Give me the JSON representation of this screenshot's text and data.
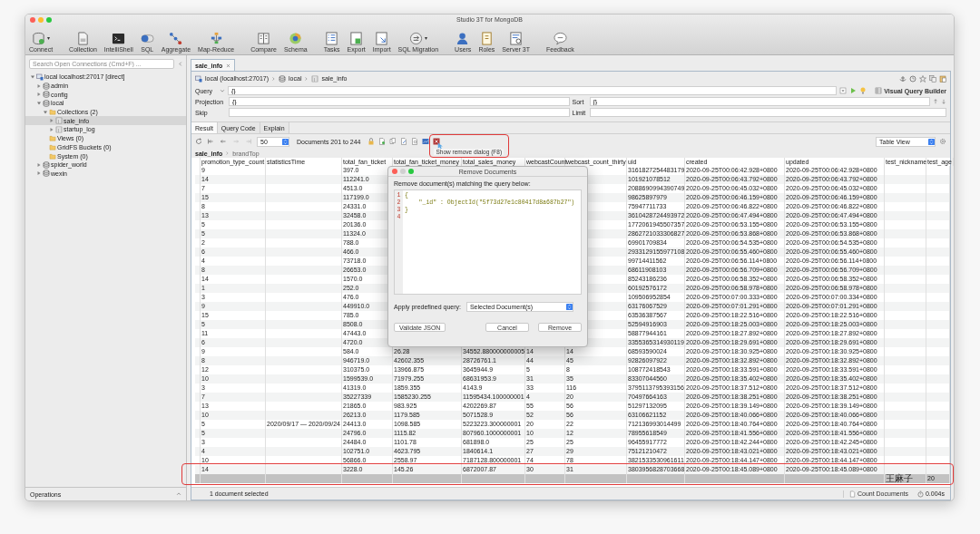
{
  "window": {
    "title": "Studio 3T for MongoDB"
  },
  "toolbar": {
    "groups": [
      [
        {
          "label": "Connect",
          "dropdown": true
        }
      ],
      [
        {
          "label": "Collection",
          "dropdown": false
        },
        {
          "label": "IntelliShell",
          "dropdown": false
        },
        {
          "label": "SQL",
          "dropdown": false
        },
        {
          "label": "Aggregate",
          "dropdown": false
        },
        {
          "label": "Map-Reduce",
          "dropdown": false
        }
      ],
      [
        {
          "label": "Compare",
          "dropdown": false
        },
        {
          "label": "Schema",
          "dropdown": false
        }
      ],
      [
        {
          "label": "Tasks",
          "dropdown": false
        },
        {
          "label": "Export",
          "dropdown": false
        },
        {
          "label": "Import",
          "dropdown": false
        },
        {
          "label": "SQL Migration",
          "dropdown": true
        }
      ],
      [
        {
          "label": "Users",
          "dropdown": false
        },
        {
          "label": "Roles",
          "dropdown": false
        },
        {
          "label": "Server 3T",
          "dropdown": false
        }
      ],
      [
        {
          "label": "Feedback",
          "dropdown": false
        }
      ]
    ]
  },
  "sidebar": {
    "search": {
      "placeholder": "Search Open Connections (Cmd+F) ..."
    },
    "tree": [
      {
        "label": "local localhost:27017 [direct]",
        "kind": "server",
        "expanded": true,
        "selected": false,
        "children": [
          {
            "label": "admin",
            "kind": "database",
            "expanded": false,
            "selected": false
          },
          {
            "label": "config",
            "kind": "database",
            "expanded": false,
            "selected": false
          },
          {
            "label": "local",
            "kind": "database",
            "expanded": true,
            "selected": false,
            "children": [
              {
                "label": "Collections (2)",
                "kind": "folder",
                "expanded": true,
                "selected": false,
                "children": [
                  {
                    "label": "sale_info",
                    "kind": "collection",
                    "expanded": false,
                    "selected": true
                  },
                  {
                    "label": "startup_log",
                    "kind": "collection",
                    "expanded": false,
                    "selected": false
                  }
                ]
              },
              {
                "label": "Views (0)",
                "kind": "folder",
                "selected": false
              },
              {
                "label": "GridFS Buckets (0)",
                "kind": "folder",
                "selected": false
              },
              {
                "label": "System (0)",
                "kind": "folder",
                "selected": false
              }
            ]
          },
          {
            "label": "spider_world",
            "kind": "database",
            "expanded": false,
            "selected": false
          },
          {
            "label": "wexin",
            "kind": "database",
            "expanded": false,
            "selected": false
          }
        ]
      }
    ],
    "footer": "Operations"
  },
  "editor_tabs": [
    {
      "label": "sale_info",
      "selected": true
    }
  ],
  "breadcrumb": [
    "local (localhost:27017)",
    "local",
    "sale_info"
  ],
  "query": {
    "label": "Query",
    "value": "{}"
  },
  "projection": {
    "label": "Projection",
    "value": "{}"
  },
  "sort": {
    "label": "Sort",
    "value": "{}"
  },
  "skip": {
    "label": "Skip"
  },
  "limit": {
    "label": "Limit"
  },
  "visual_query_builder": "Visual Query Builder",
  "result_tabs": [
    {
      "label": "Result",
      "selected": true
    },
    {
      "label": "Query Code",
      "selected": false
    },
    {
      "label": "Explain",
      "selected": false
    }
  ],
  "result_toolbar": {
    "nav_buttons": [
      {
        "disabled": false
      },
      {
        "disabled": false
      },
      {
        "disabled": true
      },
      {
        "disabled": true
      }
    ],
    "page_size": "50",
    "range": "Documents 201 to 244",
    "tooltip": "Show remove dialog (F8)",
    "view": "Table View"
  },
  "path": [
    "sale_info",
    "brandTop"
  ],
  "table": {
    "columns": [
      "promotion_type_count",
      "statisticsTime",
      "total_fan_ticket",
      "total_fan_ticket_money",
      "total_sales_money",
      "webcastCount",
      "webcast_count_thirty",
      "uid",
      "created",
      "updated",
      "test_nickname",
      "test_age"
    ],
    "rows": [
      {
        "selected": false,
        "cells": [
          "9",
          null,
          "397.0",
          null,
          null,
          null,
          null,
          "3161827254483179",
          "2020-09-25T00:06:42.928+0800",
          "2020-09-25T00:06:42.928+0800",
          null,
          null
        ]
      },
      {
        "selected": false,
        "cells": [
          "14",
          null,
          "112241.0",
          null,
          null,
          null,
          null,
          "101921078512",
          "2020-09-25T00:06:43.792+0800",
          "2020-09-25T00:06:43.792+0800",
          null,
          null
        ]
      },
      {
        "selected": false,
        "cells": [
          "7",
          null,
          "4513.0",
          null,
          null,
          null,
          null,
          "2088690994390749",
          "2020-09-25T00:06:45.032+0800",
          "2020-09-25T00:06:45.032+0800",
          null,
          null
        ]
      },
      {
        "selected": false,
        "cells": [
          "15",
          null,
          "117199.0",
          null,
          null,
          null,
          null,
          "98625897979",
          "2020-09-25T00:06:46.159+0800",
          "2020-09-25T00:06:46.159+0800",
          null,
          null
        ]
      },
      {
        "selected": false,
        "cells": [
          "8",
          null,
          "24331.0",
          null,
          null,
          null,
          null,
          "75947711733",
          "2020-09-25T00:06:46.822+0800",
          "2020-09-25T00:06:46.822+0800",
          null,
          null
        ]
      },
      {
        "selected": false,
        "cells": [
          "13",
          null,
          "32458.0",
          null,
          null,
          null,
          null,
          "3610428724493972",
          "2020-09-25T00:06:47.494+0800",
          "2020-09-25T00:06:47.494+0800",
          null,
          null
        ]
      },
      {
        "selected": false,
        "cells": [
          "5",
          null,
          "20136.0",
          null,
          null,
          null,
          null,
          "1772061945507357",
          "2020-09-25T00:06:53.155+0800",
          "2020-09-25T00:06:53.155+0800",
          null,
          null
        ]
      },
      {
        "selected": false,
        "cells": [
          "5",
          null,
          "11324.0",
          null,
          null,
          null,
          null,
          "2862721033306827",
          "2020-09-25T00:06:53.868+0800",
          "2020-09-25T00:06:53.868+0800",
          null,
          null
        ]
      },
      {
        "selected": false,
        "cells": [
          "2",
          null,
          "788.0",
          null,
          null,
          null,
          null,
          "69901709834",
          "2020-09-25T00:06:54.535+0800",
          "2020-09-25T00:06:54.535+0800",
          null,
          null
        ]
      },
      {
        "selected": false,
        "cells": [
          "6",
          null,
          "466.0",
          null,
          null,
          null,
          null,
          "2933129155977108",
          "2020-09-25T00:06:55.460+0800",
          "2020-09-25T00:06:55.460+0800",
          null,
          null
        ]
      },
      {
        "selected": false,
        "cells": [
          "4",
          null,
          "73718.0",
          null,
          null,
          null,
          null,
          "99714411562",
          "2020-09-25T00:06:56.114+0800",
          "2020-09-25T00:06:56.114+0800",
          null,
          null
        ]
      },
      {
        "selected": false,
        "cells": [
          "8",
          null,
          "26653.0",
          null,
          null,
          null,
          null,
          "68611908103",
          "2020-09-25T00:06:56.709+0800",
          "2020-09-25T00:06:56.709+0800",
          null,
          null
        ]
      },
      {
        "selected": false,
        "cells": [
          "14",
          null,
          "1570.0",
          null,
          null,
          null,
          null,
          "85243186236",
          "2020-09-25T00:06:58.352+0800",
          "2020-09-25T00:06:58.352+0800",
          null,
          null
        ]
      },
      {
        "selected": false,
        "cells": [
          "1",
          null,
          "252.0",
          null,
          null,
          null,
          null,
          "60192576172",
          "2020-09-25T00:06:58.978+0800",
          "2020-09-25T00:06:58.978+0800",
          null,
          null
        ]
      },
      {
        "selected": false,
        "cells": [
          "3",
          null,
          "476.0",
          null,
          null,
          null,
          null,
          "109506952854",
          "2020-09-25T00:07:00.333+0800",
          "2020-09-25T00:07:00.334+0800",
          null,
          null
        ]
      },
      {
        "selected": false,
        "cells": [
          "9",
          null,
          "449910.0",
          null,
          null,
          null,
          null,
          "63176067529",
          "2020-09-25T00:07:01.291+0800",
          "2020-09-25T00:07:01.291+0800",
          null,
          null
        ]
      },
      {
        "selected": false,
        "cells": [
          "15",
          null,
          "785.0",
          null,
          null,
          null,
          null,
          "63536387567",
          "2020-09-25T00:18:22.516+0800",
          "2020-09-25T00:18:22.516+0800",
          null,
          null
        ]
      },
      {
        "selected": false,
        "cells": [
          "5",
          null,
          "8508.0",
          null,
          null,
          null,
          null,
          "52594916903",
          "2020-09-25T00:18:25.003+0800",
          "2020-09-25T00:18:25.003+0800",
          null,
          null
        ]
      },
      {
        "selected": false,
        "cells": [
          "11",
          null,
          "47443.0",
          null,
          null,
          null,
          null,
          "58877944161",
          "2020-09-25T00:18:27.892+0800",
          "2020-09-25T00:18:27.892+0800",
          null,
          null
        ]
      },
      {
        "selected": false,
        "cells": [
          "6",
          null,
          "4720.0",
          null,
          null,
          null,
          null,
          "3355365314930119",
          "2020-09-25T00:18:29.691+0800",
          "2020-09-25T00:18:29.691+0800",
          null,
          null
        ]
      },
      {
        "selected": false,
        "cells": [
          "9",
          null,
          "584.0",
          "26.28",
          "34552.880000000005",
          "14",
          "14",
          "68593590024",
          "2020-09-25T00:18:30.925+0800",
          "2020-09-25T00:18:30.925+0800",
          null,
          null
        ]
      },
      {
        "selected": false,
        "cells": [
          "8",
          null,
          "946719.0",
          "42602.355",
          "28726761.1",
          "44",
          "45",
          "92826097922",
          "2020-09-25T00:18:32.892+0800",
          "2020-09-25T00:18:32.892+0800",
          null,
          null
        ]
      },
      {
        "selected": false,
        "cells": [
          "12",
          null,
          "310375.0",
          "13966.875",
          "3645944.9",
          "5",
          "8",
          "108772418543",
          "2020-09-25T00:18:33.591+0800",
          "2020-09-25T00:18:33.591+0800",
          null,
          null
        ]
      },
      {
        "selected": false,
        "cells": [
          "10",
          null,
          "1599539.0",
          "71979.255",
          "68631953.9",
          "31",
          "35",
          "83307044560",
          "2020-09-25T00:18:35.402+0800",
          "2020-09-25T00:18:35.402+0800",
          null,
          null
        ]
      },
      {
        "selected": false,
        "cells": [
          "3",
          null,
          "41319.0",
          "1859.355",
          "4143.9",
          "33",
          "116",
          "3795113795393156",
          "2020-09-25T00:18:37.512+0800",
          "2020-09-25T00:18:37.512+0800",
          null,
          null
        ]
      },
      {
        "selected": false,
        "cells": [
          "7",
          null,
          "35227339",
          "1585230.255",
          "11595434.100000001",
          "4",
          "20",
          "70497664163",
          "2020-09-25T00:18:38.251+0800",
          "2020-09-25T00:18:38.251+0800",
          null,
          null
        ]
      },
      {
        "selected": false,
        "cells": [
          "13",
          null,
          "21865.0",
          "983.925",
          "4202269.87",
          "55",
          "56",
          "51297132095",
          "2020-09-25T00:18:39.149+0800",
          "2020-09-25T00:18:39.149+0800",
          null,
          null
        ]
      },
      {
        "selected": false,
        "cells": [
          "10",
          null,
          "26213.0",
          "1179.585",
          "5071528.9",
          "52",
          "56",
          "63106621152",
          "2020-09-25T00:18:40.066+0800",
          "2020-09-25T00:18:40.066+0800",
          null,
          null
        ]
      },
      {
        "selected": false,
        "cells": [
          "5",
          "2020/09/17 — 2020/09/24",
          "24413.0",
          "1098.585",
          "5223223.300000001",
          "20",
          "22",
          "712136993014499",
          "2020-09-25T00:18:40.764+0800",
          "2020-09-25T00:18:40.764+0800",
          null,
          null
        ]
      },
      {
        "selected": false,
        "cells": [
          "5",
          null,
          "24796.0",
          "1115.82",
          "807960.1000000001",
          "10",
          "12",
          "78955618549",
          "2020-09-25T00:18:41.556+0800",
          "2020-09-25T00:18:41.556+0800",
          null,
          null
        ]
      },
      {
        "selected": false,
        "cells": [
          "3",
          null,
          "24484.0",
          "1101.78",
          "681898.0",
          "25",
          "25",
          "96455917772",
          "2020-09-25T00:18:42.244+0800",
          "2020-09-25T00:18:42.245+0800",
          null,
          null
        ]
      },
      {
        "selected": false,
        "cells": [
          "4",
          null,
          "102751.0",
          "4623.795",
          "1840614.1",
          "27",
          "29",
          "75121210472",
          "2020-09-25T00:18:43.021+0800",
          "2020-09-25T00:18:43.021+0800",
          null,
          null
        ]
      },
      {
        "selected": false,
        "cells": [
          "10",
          null,
          "56866.0",
          "2558.97",
          "7187128.800000001",
          "74",
          "78",
          "3821533530961611",
          "2020-09-25T00:18:44.147+0800",
          "2020-09-25T00:18:44.147+0800",
          null,
          null
        ]
      },
      {
        "selected": false,
        "cells": [
          "14",
          null,
          "3228.0",
          "145.26",
          "6872007.87",
          "30",
          "31",
          "3803956828703668",
          "2020-09-25T00:18:45.089+0800",
          "2020-09-25T00:18:45.089+0800",
          null,
          null
        ]
      },
      {
        "selected": true,
        "cells": [
          null,
          null,
          null,
          null,
          null,
          null,
          null,
          null,
          null,
          null,
          "王麻子",
          "20"
        ]
      }
    ]
  },
  "dialog": {
    "title": "Remove Documents",
    "prompt": "Remove document(s) matching the query below:",
    "line_numbers": [
      "1",
      "2",
      "3",
      "4"
    ],
    "code": [
      "{",
      "    \"_id\" : ObjectId(\"5f73d27e1c80417d8a687b27\")",
      "}"
    ],
    "predefined_label": "Apply predefined query:",
    "predefined_value": "Selected Document(s)",
    "buttons": [
      "Validate JSON",
      "Cancel",
      "Remove"
    ]
  },
  "status_bar": {
    "selection": "1 document selected",
    "count_button": "Count Documents",
    "time": "0.004s"
  }
}
